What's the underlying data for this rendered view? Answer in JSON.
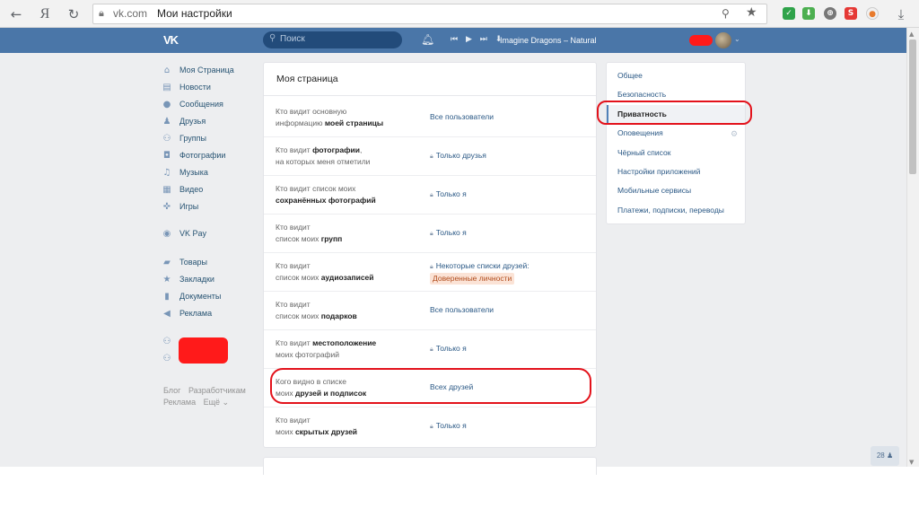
{
  "browser": {
    "back_icon": "arrow-left-icon",
    "yandex_label": "Я",
    "reload_icon": "reload-icon",
    "domain": "vk.com",
    "page_title": "Мои настройки"
  },
  "header": {
    "logo": "VK",
    "search_placeholder": "Поиск",
    "track": "Imagine Dragons – Natural"
  },
  "sidenav": {
    "items": [
      {
        "label": "Моя Страница",
        "icon": "home-icon"
      },
      {
        "label": "Новости",
        "icon": "news-icon"
      },
      {
        "label": "Сообщения",
        "icon": "chat-icon"
      },
      {
        "label": "Друзья",
        "icon": "person-icon"
      },
      {
        "label": "Группы",
        "icon": "group-icon"
      },
      {
        "label": "Фотографии",
        "icon": "camera-icon"
      },
      {
        "label": "Музыка",
        "icon": "music-icon"
      },
      {
        "label": "Видео",
        "icon": "video-icon"
      },
      {
        "label": "Игры",
        "icon": "gamepad-icon"
      },
      {
        "label": "VK Pay",
        "icon": "vkpay-icon"
      },
      {
        "label": "Товары",
        "icon": "bag-icon"
      },
      {
        "label": "Закладки",
        "icon": "star-icon"
      },
      {
        "label": "Документы",
        "icon": "document-icon"
      },
      {
        "label": "Реклама",
        "icon": "megaphone-icon"
      }
    ],
    "footer": {
      "blog": "Блог",
      "developers": "Разработчикам",
      "ads": "Реклама",
      "more": "Ещё ⌄"
    }
  },
  "settings_card": {
    "title": "Моя страница",
    "rows": [
      {
        "q1": "Кто видит основную",
        "q2": "информацию ",
        "q2b": "моей страницы",
        "value": "Все пользователи",
        "locked": false
      },
      {
        "q1": "Кто видит ",
        "q1b": "фотографии",
        "q1c": ",",
        "q2": "на которых меня отметили",
        "value": "Только друзья",
        "locked": true
      },
      {
        "q1": "Кто видит список моих",
        "q2b": "сохранённых фотографий",
        "value": "Только я",
        "locked": true
      },
      {
        "q1": "Кто видит",
        "q2": "список моих ",
        "q2b": "групп",
        "value": "Только я",
        "locked": true
      },
      {
        "q1": "Кто видит",
        "q2": "список моих ",
        "q2b": "аудиозаписей",
        "value": "Некоторые списки друзей:",
        "tag": "Доверенные личности",
        "locked": true
      },
      {
        "q1": "Кто видит",
        "q2": "список моих ",
        "q2b": "подарков",
        "value": "Все пользователи",
        "locked": false
      },
      {
        "q1": "Кто видит ",
        "q1b": "местоположение",
        "q2": "моих фотографий",
        "value": "Только я",
        "locked": true
      },
      {
        "q1": "Кого видно в списке",
        "q2": "моих ",
        "q2b": "друзей и подписок",
        "value": "Всех друзей",
        "locked": false
      },
      {
        "q1": "Кто видит",
        "q2": "моих ",
        "q2b": "скрытых друзей",
        "value": "Только я",
        "locked": true
      }
    ]
  },
  "settings_menu": {
    "items": [
      {
        "label": "Общее",
        "active": false
      },
      {
        "label": "Безопасность",
        "active": false
      },
      {
        "label": "Приватность",
        "active": true
      },
      {
        "label": "Оповещения",
        "active": false
      },
      {
        "label": "Чёрный список",
        "active": false
      },
      {
        "label": "Настройки приложений",
        "active": false
      },
      {
        "label": "Мобильные сервисы",
        "active": false
      },
      {
        "label": "Платежи, подписки, переводы",
        "active": false
      }
    ]
  },
  "online_badge": "28",
  "colors": {
    "vk_blue": "#4a76a8",
    "link": "#2a5885",
    "annotation_red": "#e3121b"
  }
}
